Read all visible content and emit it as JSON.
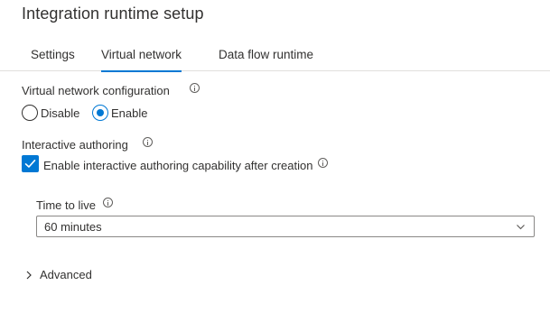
{
  "title": "Integration runtime setup",
  "tabs": [
    {
      "label": "Settings",
      "active": false
    },
    {
      "label": "Virtual network",
      "active": true
    },
    {
      "label": "Data flow runtime",
      "active": false
    }
  ],
  "vnet": {
    "label": "Virtual network configuration",
    "options": [
      {
        "label": "Disable",
        "selected": false
      },
      {
        "label": "Enable",
        "selected": true
      }
    ]
  },
  "interactive": {
    "label": "Interactive authoring",
    "checkbox_label": "Enable interactive authoring capability after creation",
    "checked": true
  },
  "ttl": {
    "label": "Time to live",
    "value": "60 minutes"
  },
  "advanced": {
    "label": "Advanced"
  },
  "colors": {
    "accent": "#0078d4",
    "text": "#323130",
    "border": "#8a8886"
  }
}
